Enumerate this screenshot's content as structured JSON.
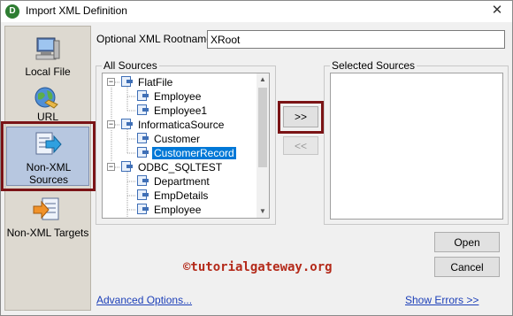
{
  "window": {
    "title": "Import XML Definition",
    "app_icon_letter": "D",
    "close_glyph": "✕"
  },
  "sidebar": {
    "items": [
      {
        "label": "Local File",
        "icon": "computer-icon"
      },
      {
        "label": "URL",
        "icon": "globe-icon"
      },
      {
        "label": "Non-XML Sources",
        "icon": "source-arrow-icon",
        "selected": true
      },
      {
        "label": "Non-XML Targets",
        "icon": "target-arrow-icon"
      }
    ]
  },
  "rootname": {
    "label": "Optional XML Rootname:",
    "value": "XRoot"
  },
  "all_sources": {
    "title": "All Sources",
    "tree": [
      {
        "label": "FlatFile",
        "expander": "−",
        "children": [
          "Employee",
          "Employee1"
        ]
      },
      {
        "label": "InformaticaSource",
        "expander": "−",
        "children": [
          "Customer",
          "CustomerRecord"
        ],
        "selected_child": "CustomerRecord"
      },
      {
        "label": "ODBC_SQLTEST",
        "expander": "−",
        "children": [
          "Department",
          "EmpDetails",
          "Employee"
        ]
      }
    ]
  },
  "selected_sources": {
    "title": "Selected Sources",
    "items": []
  },
  "buttons": {
    "add": ">>",
    "remove": "<<",
    "open": "Open",
    "cancel": "Cancel"
  },
  "watermark": "©tutorialgateway.org",
  "links": {
    "advanced": "Advanced Options...",
    "errors": "Show Errors >>"
  },
  "colors": {
    "highlight": "#7b1416",
    "selection": "#0078d7",
    "link": "#1c3fb8",
    "watermark": "#b42a1a"
  }
}
